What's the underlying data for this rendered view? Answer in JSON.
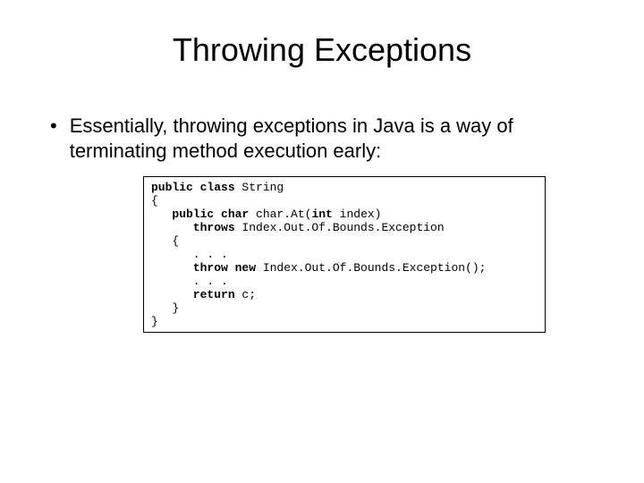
{
  "title": "Throwing Exceptions",
  "bullet": "Essentially, throwing exceptions in Java is a way of terminating method execution early:",
  "code": {
    "l1a": "public class ",
    "l1b": "String",
    "l2": "{",
    "l3a": "   public char ",
    "l3b": "char.At(",
    "l3c": "int ",
    "l3d": "index)",
    "l4a": "      throws ",
    "l4b": "Index.Out.Of.Bounds.Exception",
    "l5": "   {",
    "l6": "      . . .",
    "l7a": "      throw new ",
    "l7b": "Index.Out.Of.Bounds.Exception();",
    "l8": "      . . .",
    "l9a": "      return ",
    "l9b": "c;",
    "l10": "   }",
    "l11": "}"
  }
}
